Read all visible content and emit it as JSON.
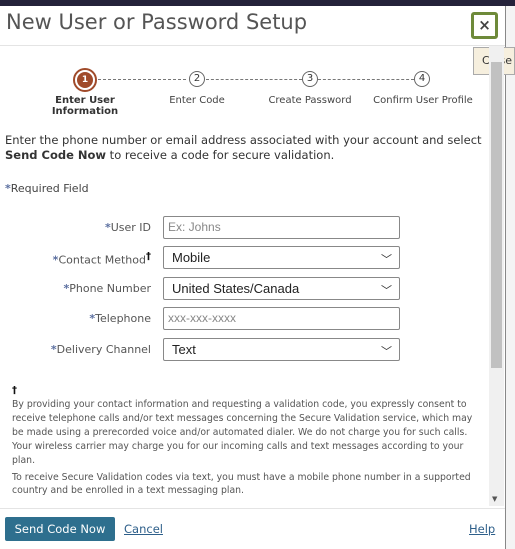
{
  "dialog": {
    "title": "New User or Password Setup",
    "close_icon": "×",
    "close_tooltip": "Close"
  },
  "steps": [
    {
      "number": "1",
      "label": "Enter User Information",
      "active": true
    },
    {
      "number": "2",
      "label": "Enter Code"
    },
    {
      "number": "3",
      "label": "Create Password"
    },
    {
      "number": "4",
      "label": "Confirm User Profile"
    }
  ],
  "intro": {
    "text_before": "Enter the phone number or email address associated with your account and select ",
    "bold": "Send Code Now",
    "text_after": " to receive a code for secure validation."
  },
  "required": {
    "asterisk": "*",
    "label": "Required Field"
  },
  "form": {
    "user_id": {
      "label": "User ID",
      "placeholder": "Ex: Johns",
      "value": ""
    },
    "contact_method": {
      "label": "Contact Method",
      "dagger": "†",
      "value": "Mobile"
    },
    "phone_number": {
      "label": "Phone Number",
      "value": "United States/Canada"
    },
    "telephone": {
      "label": "Telephone",
      "placeholder": "xxx-xxx-xxxx",
      "value": ""
    },
    "delivery_channel": {
      "label": "Delivery Channel",
      "value": "Text"
    }
  },
  "consent": {
    "dagger": "†",
    "text": "By providing your contact information and requesting a validation code, you expressly consent to receive telephone calls and/or text messages concerning the Secure Validation service, which may be made using a prerecorded voice and/or automated dialer. We do not charge you for such calls. Your wireless carrier may charge you for our incoming calls and text messages according to your plan."
  },
  "note": "To receive Secure Validation codes via text, you must have a mobile phone number in a supported country and be enrolled in a text messaging plan.",
  "footer": {
    "send_label": "Send Code Now",
    "cancel_label": "Cancel",
    "help_label": "Help"
  },
  "colors": {
    "accent": "#2e6f8e",
    "active_step": "#a04a2a",
    "close_border": "#6e8a3a",
    "asterisk": "#5b6fa0"
  }
}
